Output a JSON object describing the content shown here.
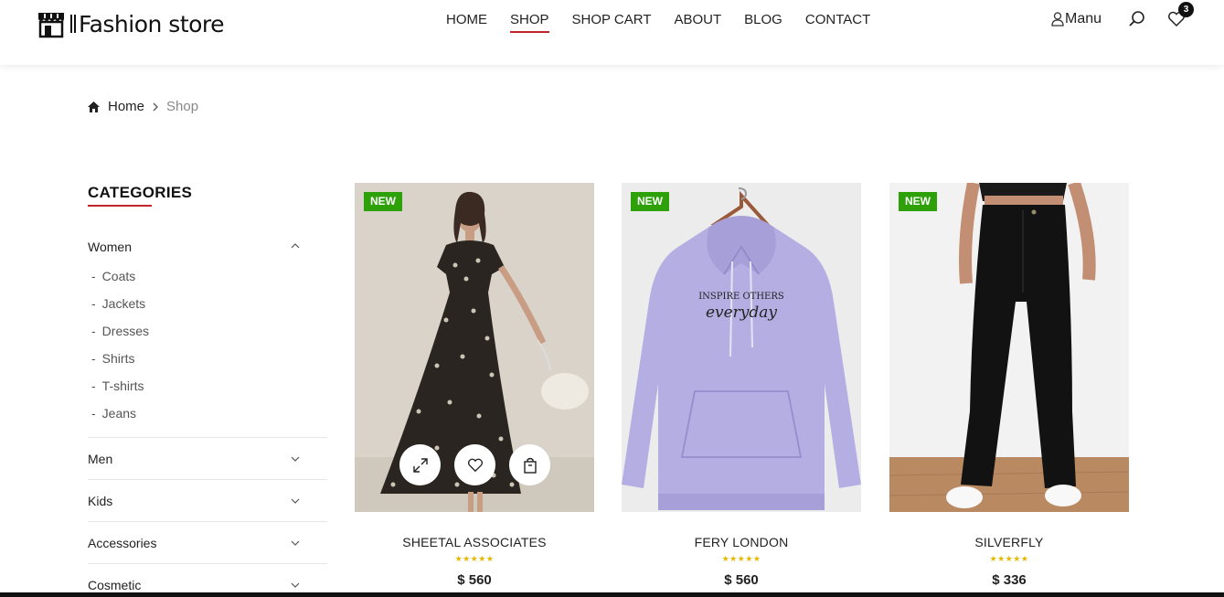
{
  "header": {
    "logo_text": "Fashion store",
    "nav": [
      "HOME",
      "SHOP",
      "SHOP CART",
      "ABOUT",
      "BLOG",
      "CONTACT"
    ],
    "active_nav": "SHOP",
    "user_label": "Manu",
    "wishlist_count": "3",
    "accent_color": "#c0252a"
  },
  "breadcrumb": {
    "home": "Home",
    "current": "Shop"
  },
  "sidebar": {
    "title": "CATEGORIES",
    "categories": [
      {
        "label": "Women",
        "expanded": true,
        "children": [
          "Coats",
          "Jackets",
          "Dresses",
          "Shirts",
          "T-shirts",
          "Jeans"
        ]
      },
      {
        "label": "Men",
        "expanded": false
      },
      {
        "label": "Kids",
        "expanded": false
      },
      {
        "label": "Accessories",
        "expanded": false
      },
      {
        "label": "Cosmetic",
        "expanded": false
      }
    ]
  },
  "products": [
    {
      "tag": "NEW",
      "name": "SHEETAL ASSOCIATES",
      "stars": "★★★★★",
      "price": "$ 560",
      "image": "floral-dress-photo",
      "hovered": true
    },
    {
      "tag": "NEW",
      "name": "FERY LONDON",
      "stars": "★★★★★",
      "price": "$ 560",
      "image": "lavender-hoodie-photo",
      "print_line1": "INSPIRE OTHERS",
      "print_line2": "everyday"
    },
    {
      "tag": "NEW",
      "name": "SILVERFLY",
      "stars": "★★★★★",
      "price": "$ 336",
      "image": "black-trousers-photo"
    }
  ],
  "icons": [
    "store-logo-icon",
    "user-icon",
    "search-icon",
    "heart-icon",
    "home-icon",
    "chevron-right-icon",
    "chevron-up-icon",
    "chevron-down-icon",
    "expand-icon",
    "wishlist-icon",
    "bag-icon"
  ],
  "colors": {
    "new_tag": "#2ea10a",
    "star": "#e6b800",
    "hoodie": "#b4aee3"
  }
}
